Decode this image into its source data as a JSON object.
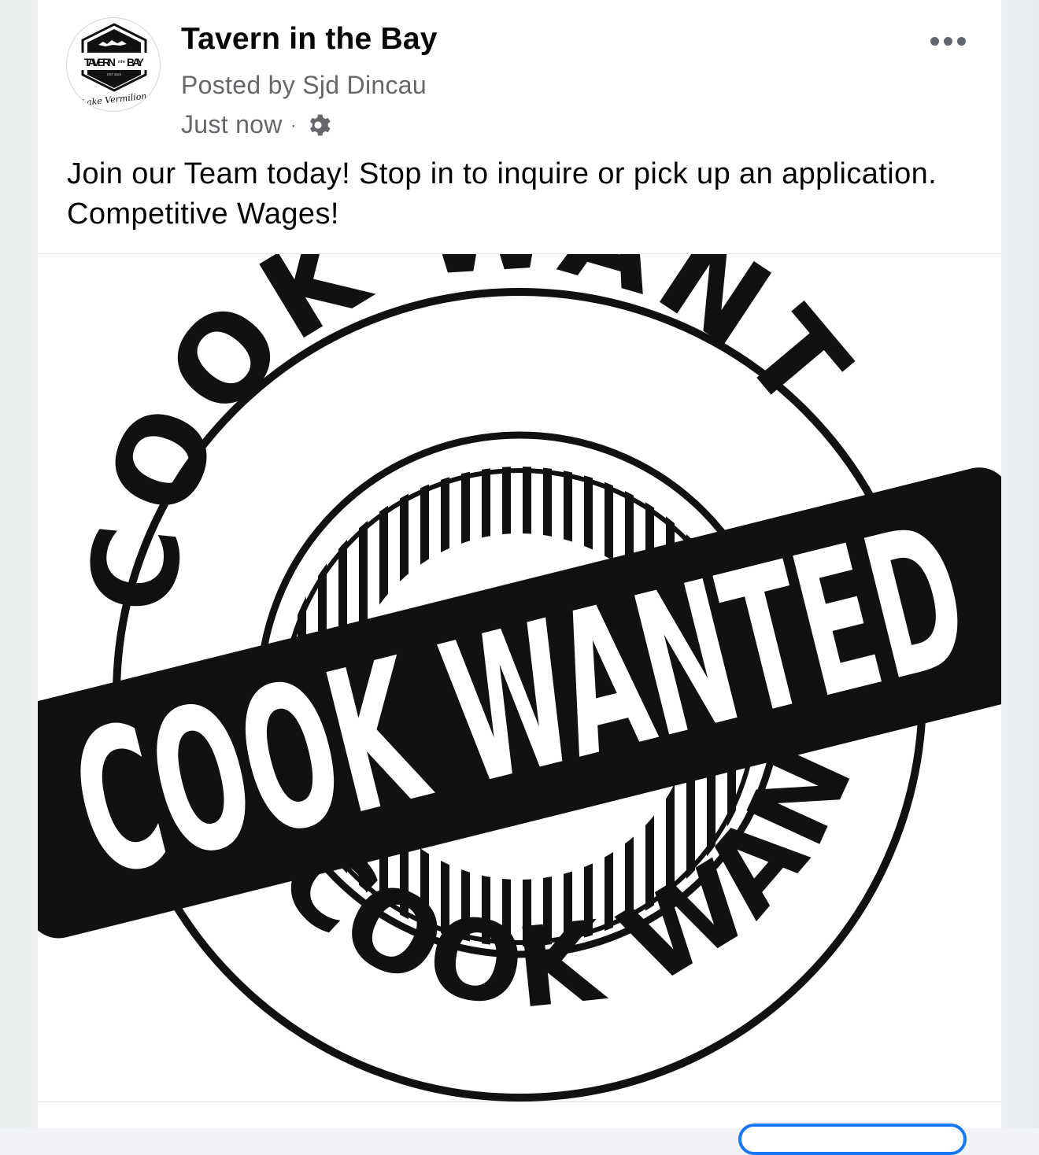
{
  "post": {
    "page_name": "Tavern in the Bay",
    "posted_by": "Posted by Sjd Dincau",
    "timestamp": "Just now",
    "separator": "·",
    "privacy_icon": "gear-icon",
    "more_icon": "more-options-icon",
    "message": "Join our Team today! Stop in to inquire or pick up an application. Competitive Wages!"
  },
  "avatar_logo": {
    "name_left": "TAVERN",
    "name_middle": "in the",
    "name_right": "BAY",
    "est": "EST 2023",
    "script": "Lake Vermilion"
  },
  "image": {
    "banner_text": "COOK WANTED",
    "top_arc_text": "COOK WANTED",
    "bottom_arc_text": "COOK WANTED"
  },
  "colors": {
    "page_name": "#050505",
    "secondary_text": "#65676b",
    "accent": "#1877f2",
    "stamp": "#111111"
  }
}
